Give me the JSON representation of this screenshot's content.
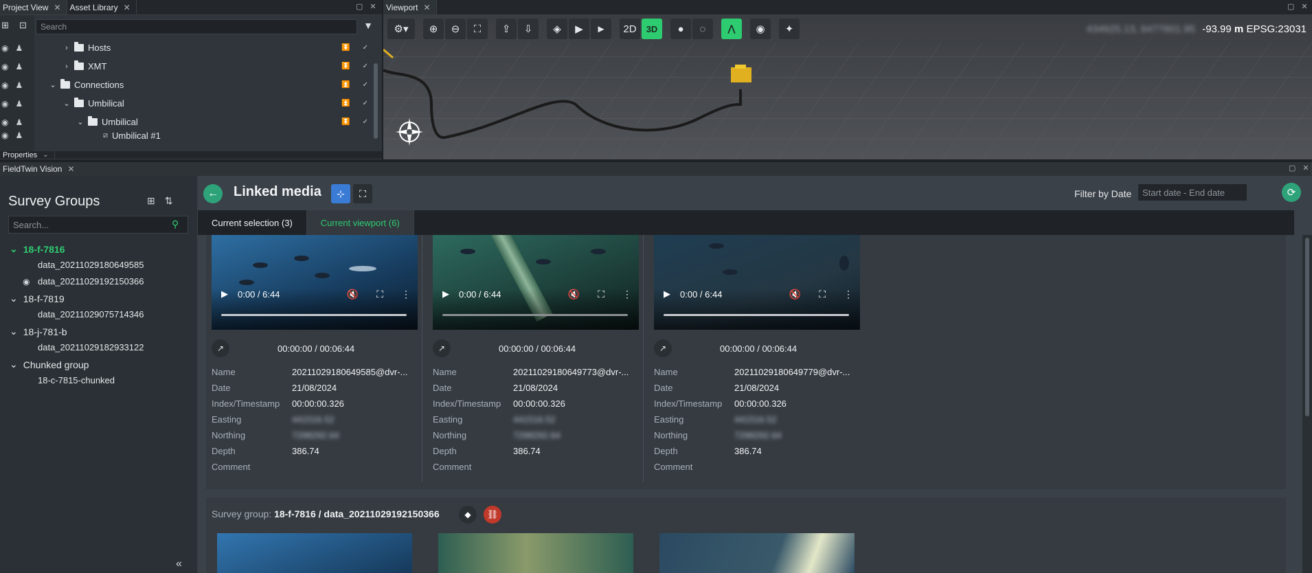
{
  "top_tabs": {
    "left": [
      {
        "label": "Project View"
      },
      {
        "label": "Asset Library"
      }
    ],
    "viewport": {
      "label": "Viewport"
    },
    "bottom": {
      "label": "FieldTwin Vision"
    },
    "properties": {
      "label": "Properties"
    }
  },
  "project": {
    "search_placeholder": "Search",
    "tree": [
      {
        "label": "Hosts",
        "indent": 2,
        "expanded": false,
        "rt": "↡"
      },
      {
        "label": "XMT",
        "indent": 2,
        "expanded": false,
        "rt": "↡"
      },
      {
        "label": "Connections",
        "indent": 1,
        "expanded": true,
        "rt": "↟"
      },
      {
        "label": "Umbilical",
        "indent": 2,
        "expanded": true,
        "rt": "↟"
      },
      {
        "label": "Umbilical",
        "indent": 3,
        "expanded": true,
        "rt": "↡"
      },
      {
        "label": "Umbilical #1",
        "indent": 4,
        "expanded": false,
        "rt": ""
      }
    ]
  },
  "viewport": {
    "toolbar": [
      "gear-icon",
      "zoom-in-icon",
      "zoom-out-icon",
      "fit-icon",
      "upload-icon",
      "download-icon",
      "layers-icon",
      "camera-icon",
      "play-icon"
    ],
    "mode_2d": "2D",
    "mode_3d": "3D",
    "coords_blurred": "434925.13, 6477601.95",
    "depth": "-93.99",
    "depth_unit": "m",
    "epsg": "EPSG:23031"
  },
  "vision": {
    "survey_groups_title": "Survey Groups",
    "search_placeholder": "Search...",
    "groups": [
      {
        "name": "18-f-7816",
        "selected": true,
        "items": [
          "data_20211029180649585",
          "data_20211029192150366"
        ]
      },
      {
        "name": "18-f-7819",
        "selected": false,
        "items": [
          "data_20211029075714346"
        ]
      },
      {
        "name": "18-j-781-b",
        "selected": false,
        "items": [
          "data_20211029182933122"
        ]
      },
      {
        "name": "Chunked group",
        "selected": false,
        "items": [
          "18-c-7815-chunked"
        ]
      }
    ],
    "linked_media_title": "Linked media",
    "filter_label": "Filter by Date",
    "date_placeholder": "Start date - End date",
    "tab_selection": "Current selection (3)",
    "tab_viewport": "Current viewport (6)",
    "player_time": "0:00 / 6:44",
    "clip_time": "00:00:00 / 00:06:44",
    "labels": {
      "name": "Name",
      "date": "Date",
      "index": "Index/Timestamp",
      "easting": "Easting",
      "northing": "Northing",
      "depth": "Depth",
      "comment": "Comment"
    },
    "cards": [
      {
        "name": "20211029180649585@dvr-...",
        "date": "21/08/2024",
        "index": "00:00:00.326",
        "easting": "441516.52",
        "northing": "7298292.64",
        "depth": "386.74",
        "comment": ""
      },
      {
        "name": "20211029180649773@dvr-...",
        "date": "21/08/2024",
        "index": "00:00:00.326",
        "easting": "441516.52",
        "northing": "7298292.64",
        "depth": "386.74",
        "comment": ""
      },
      {
        "name": "20211029180649779@dvr-...",
        "date": "21/08/2024",
        "index": "00:00:00.326",
        "easting": "441516.52",
        "northing": "7298292.64",
        "depth": "386.74",
        "comment": ""
      }
    ],
    "survey_group_label": "Survey group:",
    "survey_group_value": "18-f-7816 / data_20211029192150366"
  }
}
